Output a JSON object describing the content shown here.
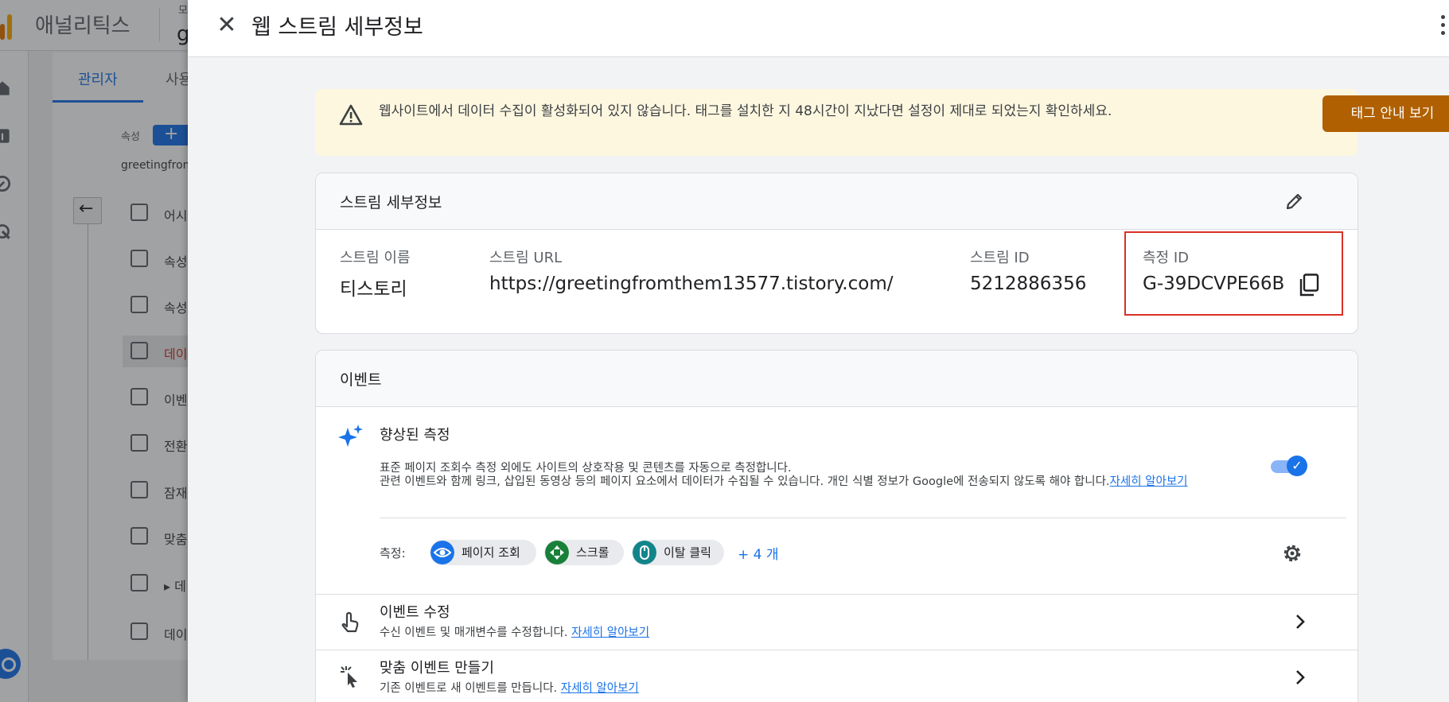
{
  "background": {
    "app_title": "애널리틱스",
    "account_small": "모",
    "account_big": "g",
    "tabs": {
      "admin": "관리자",
      "user": "사용"
    },
    "property_label": "속성",
    "property_add": "+",
    "property_name": "greetingfromt",
    "nav_items": [
      {
        "label": "어시"
      },
      {
        "label": "속성"
      },
      {
        "label": "속성"
      },
      {
        "label": "데이"
      },
      {
        "label": "이벤"
      },
      {
        "label": "전환"
      },
      {
        "label": "잠재"
      },
      {
        "label": "맞춤"
      },
      {
        "label": "▸ 데"
      },
      {
        "label": "데이"
      }
    ]
  },
  "drawer": {
    "title": "웹 스트림 세부정보",
    "close_icon": "close-icon",
    "more_icon": "more-vert-icon"
  },
  "banner": {
    "text": "웹사이트에서 데이터 수집이 활성화되어 있지 않습니다. 태그를 설치한 지 48시간이 지났다면 설정이 제대로 되었는지 확인하세요.",
    "button": "태그 안내 보기",
    "icon": "warning-icon",
    "color": "#fef7e0",
    "button_color": "#b06000"
  },
  "stream": {
    "title": "스트림 세부정보",
    "fields": {
      "name": {
        "label": "스트림 이름",
        "value": "티스토리"
      },
      "url": {
        "label": "스트림 URL",
        "value": "https://greetingfromthem13577.tistory.com/"
      },
      "id": {
        "label": "스트림 ID",
        "value": "5212886356"
      },
      "measurement": {
        "label": "측정 ID",
        "value": "G-39DCVPE66B"
      }
    },
    "highlight_color": "#d93025"
  },
  "events": {
    "title": "이벤트",
    "enhanced": {
      "title": "향상된 측정",
      "desc1": "표준 페이지 조회수 측정 외에도 사이트의 상호작용 및 콘텐츠를 자동으로 측정합니다.",
      "desc2": "관련 이벤트와 함께 링크, 삽입된 동영상 등의 페이지 요소에서 데이터가 수집될 수 있습니다. 개인 식별 정보가 Google에 전송되지 않도록 해야 합니다.",
      "link": "자세히 알아보기",
      "enabled": true
    },
    "measure_label": "측정:",
    "chips": [
      {
        "label": "페이지 조회",
        "color": "#1a73e8",
        "icon": "eye-icon"
      },
      {
        "label": "스크롤",
        "color": "#188038",
        "icon": "scroll-icon"
      },
      {
        "label": "이탈 클릭",
        "color": "#12848a",
        "icon": "mouse-icon"
      }
    ],
    "more": "+ 4 개",
    "rows": [
      {
        "title": "이벤트 수정",
        "desc": "수신 이벤트 및 매개변수를 수정합니다.",
        "link": "자세히 알아보기"
      },
      {
        "title": "맞춤 이벤트 만들기",
        "desc": "기존 이벤트로 새 이벤트를 만듭니다.",
        "link": "자세히 알아보기"
      }
    ]
  }
}
